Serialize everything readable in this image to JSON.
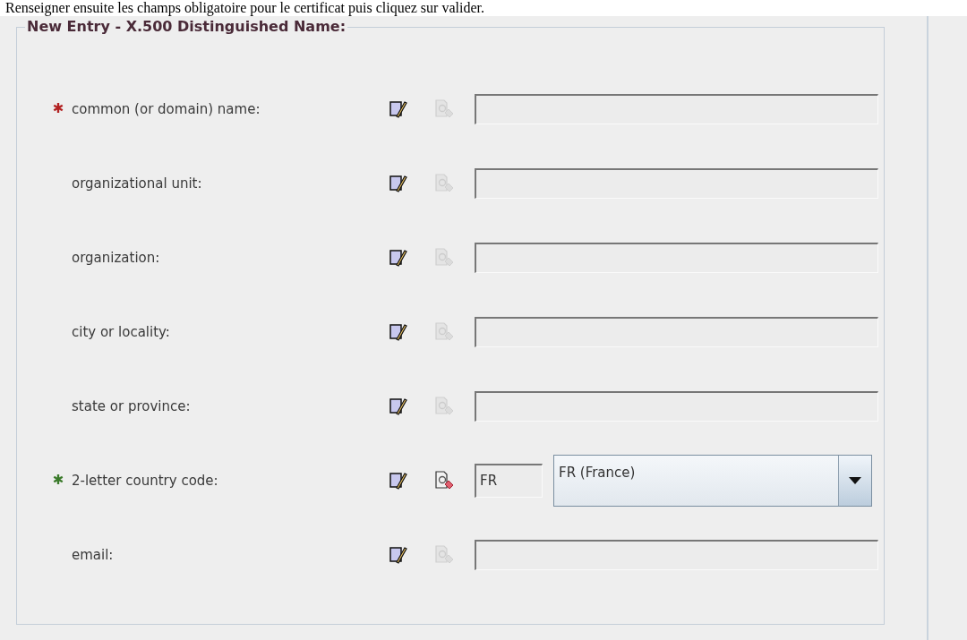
{
  "instruction": "Renseigner ensuite les champs obligatoire pour le certificat puis cliquez sur valider.",
  "panel": {
    "title": "New Entry - X.500 Distinguished Name:",
    "rows": [
      {
        "kind": "text",
        "label": "common (or domain) name:",
        "required_mark": {
          "text": "✱",
          "color": "#b22222"
        },
        "lookup_enabled": false
      },
      {
        "kind": "text",
        "label": "organizational unit:",
        "lookup_enabled": false
      },
      {
        "kind": "text",
        "label": "organization:",
        "lookup_enabled": false
      },
      {
        "kind": "text",
        "label": "city or locality:",
        "lookup_enabled": false
      },
      {
        "kind": "text",
        "label": "state or province:",
        "lookup_enabled": false
      },
      {
        "kind": "country",
        "label": "2-letter country code:",
        "required_mark": {
          "text": "✱",
          "color": "#3a7a2a"
        },
        "lookup_enabled": true,
        "code": "FR",
        "selection": "FR (France)"
      },
      {
        "kind": "text",
        "label": "email:",
        "lookup_enabled": false
      }
    ]
  }
}
